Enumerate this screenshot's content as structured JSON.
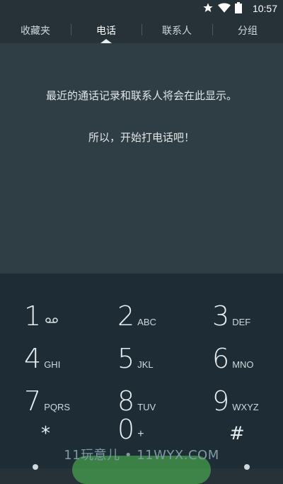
{
  "status": {
    "time": "10:57"
  },
  "tabs": [
    {
      "label": "收藏夹",
      "active": false
    },
    {
      "label": "电话",
      "active": true
    },
    {
      "label": "联系人",
      "active": false
    },
    {
      "label": "分组",
      "active": false
    }
  ],
  "empty_state": {
    "message": "最近的通话记录和联系人将会在此显示。",
    "cta": "所以，开始打电话吧！"
  },
  "dialpad": {
    "keys": [
      {
        "digit": "1",
        "letters": "",
        "icon": "voicemail-icon"
      },
      {
        "digit": "2",
        "letters": "ABC"
      },
      {
        "digit": "3",
        "letters": "DEF"
      },
      {
        "digit": "4",
        "letters": "GHI"
      },
      {
        "digit": "5",
        "letters": "JKL"
      },
      {
        "digit": "6",
        "letters": "MNO"
      },
      {
        "digit": "7",
        "letters": "PQRS"
      },
      {
        "digit": "8",
        "letters": "TUV"
      },
      {
        "digit": "9",
        "letters": "WXYZ"
      },
      {
        "digit": "*",
        "letters": ""
      },
      {
        "digit": "0",
        "letters": "+"
      },
      {
        "digit": "#",
        "letters": ""
      }
    ]
  },
  "watermark": "11玩意儿 • 11WYX.COM",
  "colors": {
    "background": "#263238",
    "content": "#2f3e44",
    "dialpad": "#1e2d35",
    "accent": "#4caf50"
  }
}
